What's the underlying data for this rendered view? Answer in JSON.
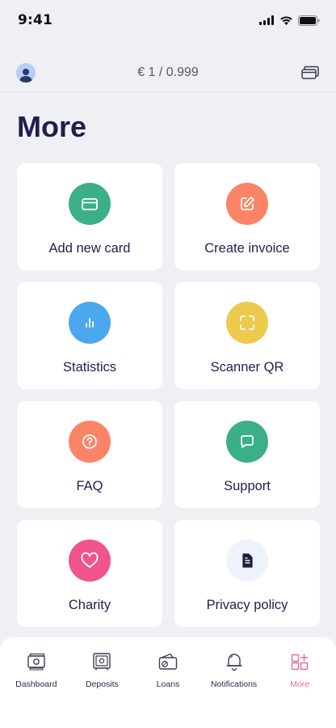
{
  "status": {
    "time": "9:41"
  },
  "header": {
    "balance": "€ 1 / 0.999"
  },
  "page": {
    "title": "More"
  },
  "tiles": [
    {
      "label": "Add new card",
      "color": "#3bb087",
      "icon": "credit-card-icon"
    },
    {
      "label": "Create invoice",
      "color": "#fb8466",
      "icon": "edit-icon"
    },
    {
      "label": "Statistics",
      "color": "#4ca8ee",
      "icon": "bar-chart-icon"
    },
    {
      "label": "Scanner QR",
      "color": "#edc94e",
      "icon": "scan-icon"
    },
    {
      "label": "FAQ",
      "color": "#fb8466",
      "icon": "question-icon"
    },
    {
      "label": "Support",
      "color": "#3bb087",
      "icon": "chat-icon"
    },
    {
      "label": "Charity",
      "color": "#f0548a",
      "icon": "heart-icon"
    },
    {
      "label": "Privacy policy",
      "color": "#eef2fb",
      "icon": "document-icon"
    }
  ],
  "tabbar": {
    "items": [
      {
        "label": "Dashboard",
        "icon": "money-icon",
        "active": false
      },
      {
        "label": "Deposits",
        "icon": "safe-icon",
        "active": false
      },
      {
        "label": "Loans",
        "icon": "wallet-icon",
        "active": false
      },
      {
        "label": "Notifications",
        "icon": "bell-icon",
        "active": false
      },
      {
        "label": "More",
        "icon": "grid-icon",
        "active": true
      }
    ],
    "active_color": "#e46aa0"
  }
}
